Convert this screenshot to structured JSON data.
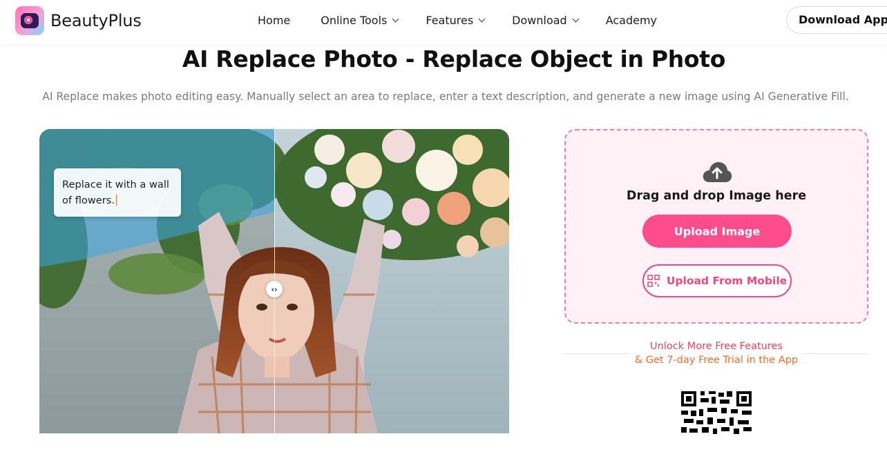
{
  "nav": {
    "brand": "BeautyPlus",
    "links": [
      {
        "label": "Home",
        "has_dropdown": false
      },
      {
        "label": "Online Tools",
        "has_dropdown": true
      },
      {
        "label": "Features",
        "has_dropdown": true
      },
      {
        "label": "Download",
        "has_dropdown": true
      },
      {
        "label": "Academy",
        "has_dropdown": false
      }
    ],
    "download_label": "Download App"
  },
  "hero": {
    "title": "AI Replace Photo - Replace Object in Photo",
    "subtitle": "AI Replace makes photo editing easy. Manually select an area to replace, enter a text description, and generate a new image using AI Generative Fill."
  },
  "demo": {
    "prompt_line1": "Replace it with a wall",
    "prompt_line2": "of flowers.",
    "handle_glyph": "‹›"
  },
  "upload": {
    "drag_text": "Drag and drop Image here",
    "upload_button": "Upload Image",
    "mobile_button": "Upload From Mobile",
    "icon": "cloud-upload-icon"
  },
  "promo": {
    "line1": "Unlock More Free Features",
    "line2": "& Get 7-day Free Trial in the App"
  },
  "colors": {
    "accent_pink": "#ff4d8b",
    "panel_bg": "#fff1f6",
    "panel_border": "#f07fa6",
    "promo_red": "#ee3f58",
    "promo_orange": "#f06a2b"
  }
}
